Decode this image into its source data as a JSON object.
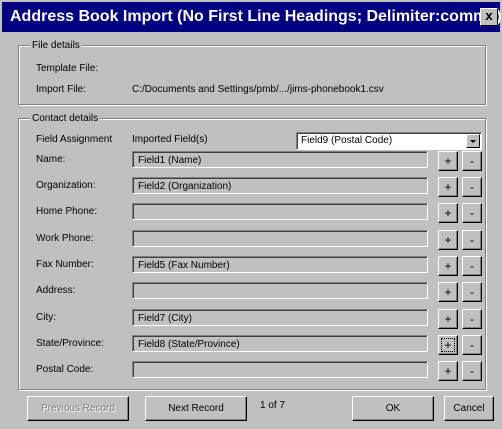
{
  "window": {
    "title": "Address Book Import (No First Line Headings; Delimiter:comma)",
    "close_label": "x"
  },
  "file_details": {
    "legend": "File details",
    "template_label": "Template File:",
    "template_value": "",
    "import_label": "Import File:",
    "import_value": "C:/Documents and Settings/pmb/.../jims-phonebook1.csv"
  },
  "contact_details": {
    "legend": "Contact details",
    "field_assignment_header": "Field Assignment",
    "imported_fields_header": "Imported Field(s)",
    "selected_field": "Field9 (Postal Code)",
    "rows": [
      {
        "label": "Name:",
        "value": "Field1 (Name)"
      },
      {
        "label": "Organization:",
        "value": "Field2 (Organization)"
      },
      {
        "label": "Home Phone:",
        "value": ""
      },
      {
        "label": "Work Phone:",
        "value": ""
      },
      {
        "label": "Fax Number:",
        "value": "Field5 (Fax Number)"
      },
      {
        "label": "Address:",
        "value": ""
      },
      {
        "label": "City:",
        "value": "Field7 (City)"
      },
      {
        "label": "State/Province:",
        "value": "Field8 (State/Province)"
      },
      {
        "label": "Postal Code:",
        "value": ""
      }
    ],
    "add_label": "+",
    "remove_label": "-"
  },
  "footer": {
    "previous_label": "Previous Record",
    "next_label": "Next Record",
    "record_position": "1 of 7",
    "ok_label": "OK",
    "cancel_label": "Cancel"
  }
}
